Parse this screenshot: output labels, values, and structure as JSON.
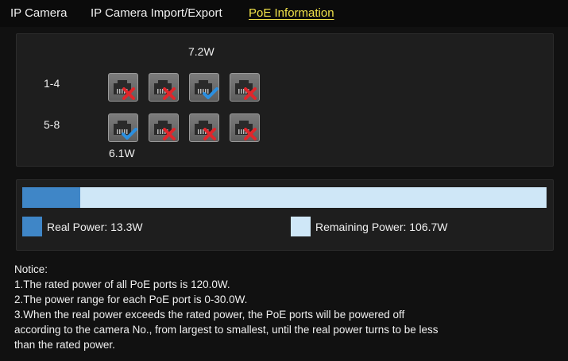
{
  "tabs": [
    {
      "label": "IP Camera",
      "active": false
    },
    {
      "label": "IP Camera Import/Export",
      "active": false
    },
    {
      "label": "PoE Information",
      "active": true
    }
  ],
  "ports": {
    "rows": [
      {
        "label": "1-4",
        "power_top": "7.2W",
        "ports": [
          {
            "status": "disconnected",
            "icon": "x-mark-icon"
          },
          {
            "status": "disconnected",
            "icon": "x-mark-icon"
          },
          {
            "status": "connected",
            "icon": "check-mark-icon"
          },
          {
            "status": "disconnected",
            "icon": "x-mark-icon"
          }
        ]
      },
      {
        "label": "5-8",
        "power_bottom": "6.1W",
        "ports": [
          {
            "status": "connected",
            "icon": "check-mark-icon"
          },
          {
            "status": "disconnected",
            "icon": "x-mark-icon"
          },
          {
            "status": "disconnected",
            "icon": "x-mark-icon"
          },
          {
            "status": "disconnected",
            "icon": "x-mark-icon"
          }
        ]
      }
    ]
  },
  "power": {
    "used_fraction": 0.111,
    "real_label": "Real Power: 13.3W",
    "remaining_label": "Remaining Power: 106.7W",
    "real_color": "#3f86c7",
    "remaining_color": "#cfe7f7"
  },
  "notice": {
    "title": "Notice:",
    "lines": [
      "1.The rated power of all PoE ports is 120.0W.",
      "2.The power range for each PoE port is 0-30.0W.",
      "3.When the real power exceeds the rated power, the PoE ports will be powered off",
      "according to the camera No., from largest to smallest, until the real power turns to be less",
      "than the rated power."
    ]
  }
}
